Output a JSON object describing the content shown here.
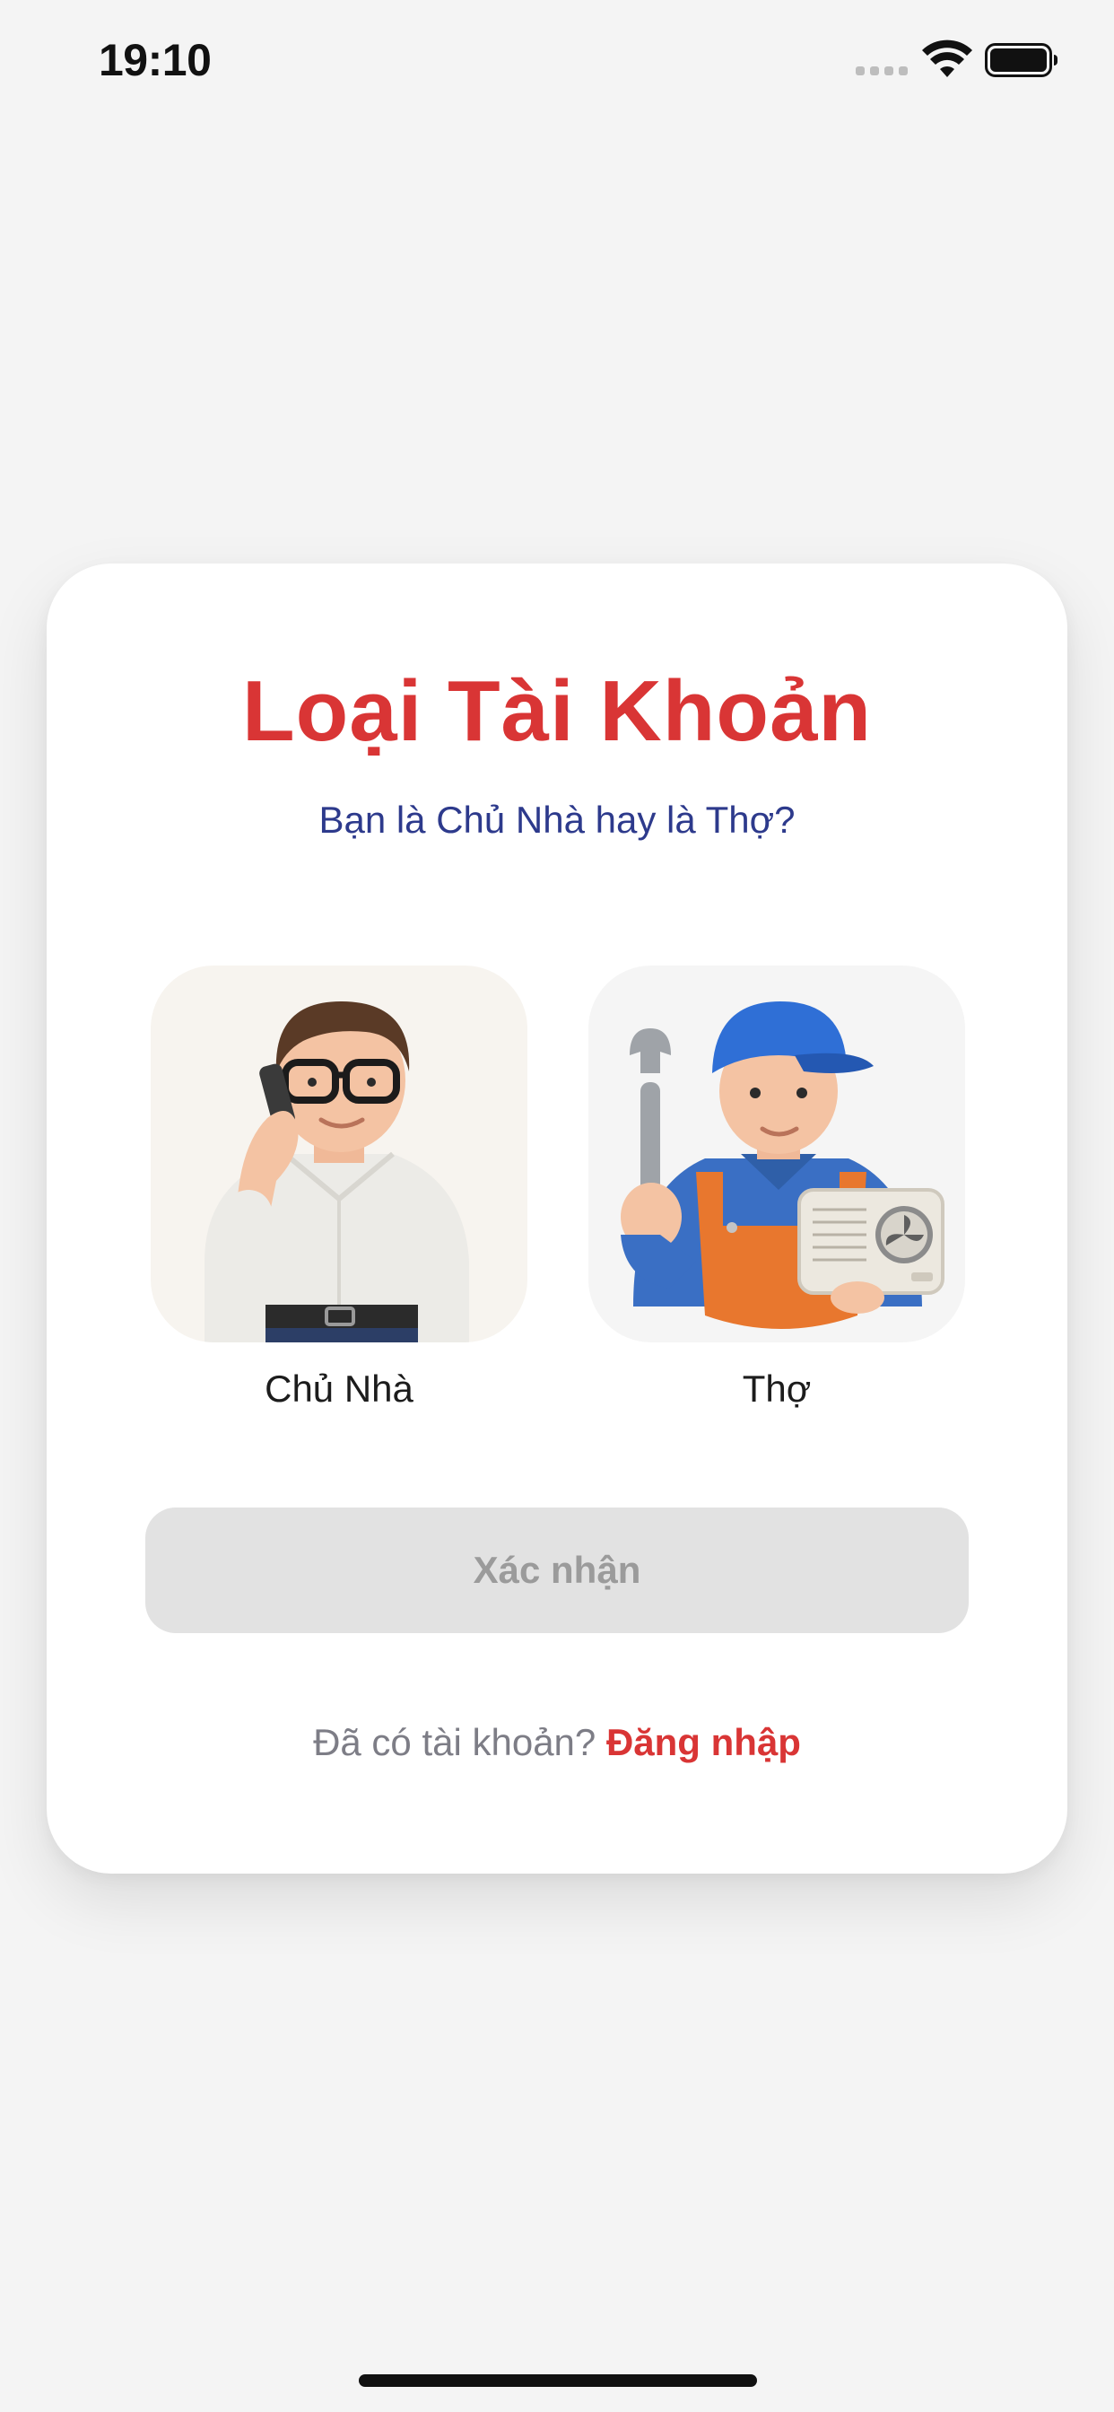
{
  "status_bar": {
    "time": "19:10",
    "signal_icon": "cellular-signal-icon",
    "wifi_icon": "wifi-icon",
    "battery_icon": "battery-icon"
  },
  "card": {
    "title": "Loại Tài Khoản",
    "subtitle": "Bạn là Chủ Nhà hay là Thợ?",
    "options": [
      {
        "label": "Chủ Nhà",
        "illustration": "homeowner-on-phone-illustration"
      },
      {
        "label": "Thợ",
        "illustration": "technician-with-wrench-and-ac-unit-illustration"
      }
    ],
    "confirm_label": "Xác nhận",
    "login_prompt": "Đã có tài khoản?",
    "login_link": "Đăng nhập"
  },
  "colors": {
    "accent": "#d93535",
    "subtitle": "#2d3a8c",
    "background": "#f4f4f4",
    "button_disabled": "#e2e2e2"
  }
}
